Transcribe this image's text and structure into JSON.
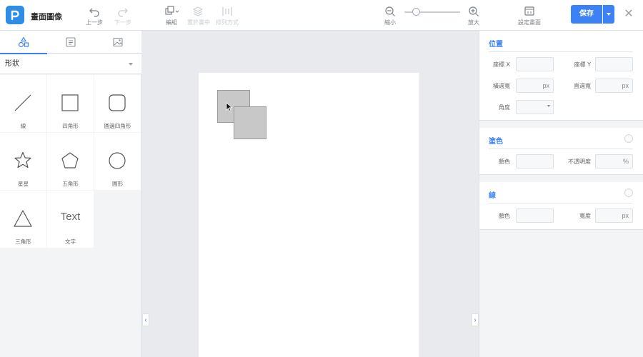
{
  "app": {
    "title": "畫面圖像"
  },
  "toolbar": {
    "undo_label": "上一步",
    "redo_label": "下一步",
    "group_label": "編組",
    "align_center_label": "置於畫中",
    "arrange_label": "排列方式",
    "zoom_out_label": "縮小",
    "zoom_in_label": "放大",
    "page_settings_label": "設定畫面",
    "save_label": "保存"
  },
  "left_panel": {
    "tabs": [
      "shapes-icon",
      "text-block-icon",
      "image-icon"
    ],
    "category": "形狀",
    "shapes": [
      {
        "label": "線",
        "icon": "line-icon"
      },
      {
        "label": "四角形",
        "icon": "square-icon"
      },
      {
        "label": "圓邊四角形",
        "icon": "rounded-square-icon"
      },
      {
        "label": "星星",
        "icon": "star-icon"
      },
      {
        "label": "五角形",
        "icon": "pentagon-icon"
      },
      {
        "label": "圓形",
        "icon": "circle-icon"
      },
      {
        "label": "三角形",
        "icon": "triangle-icon"
      },
      {
        "label": "文字",
        "icon": "text-icon",
        "sample": "Text"
      }
    ]
  },
  "properties": {
    "position": {
      "title": "位置",
      "x_label": "座標 X",
      "y_label": "座標 Y",
      "width_label": "橫週寬",
      "height_label": "直週寬",
      "angle_label": "角度",
      "width_unit": "px",
      "height_unit": "px"
    },
    "fill": {
      "title": "塗色",
      "color_label": "顏色",
      "opacity_label": "不透明度",
      "opacity_unit": "%"
    },
    "stroke": {
      "title": "線",
      "color_label": "顏色",
      "width_label": "寬度",
      "width_unit": "px"
    }
  },
  "colors": {
    "accent": "#3c82f6",
    "logo": "#2e8de6",
    "shape_fill": "#c8c8c8"
  }
}
